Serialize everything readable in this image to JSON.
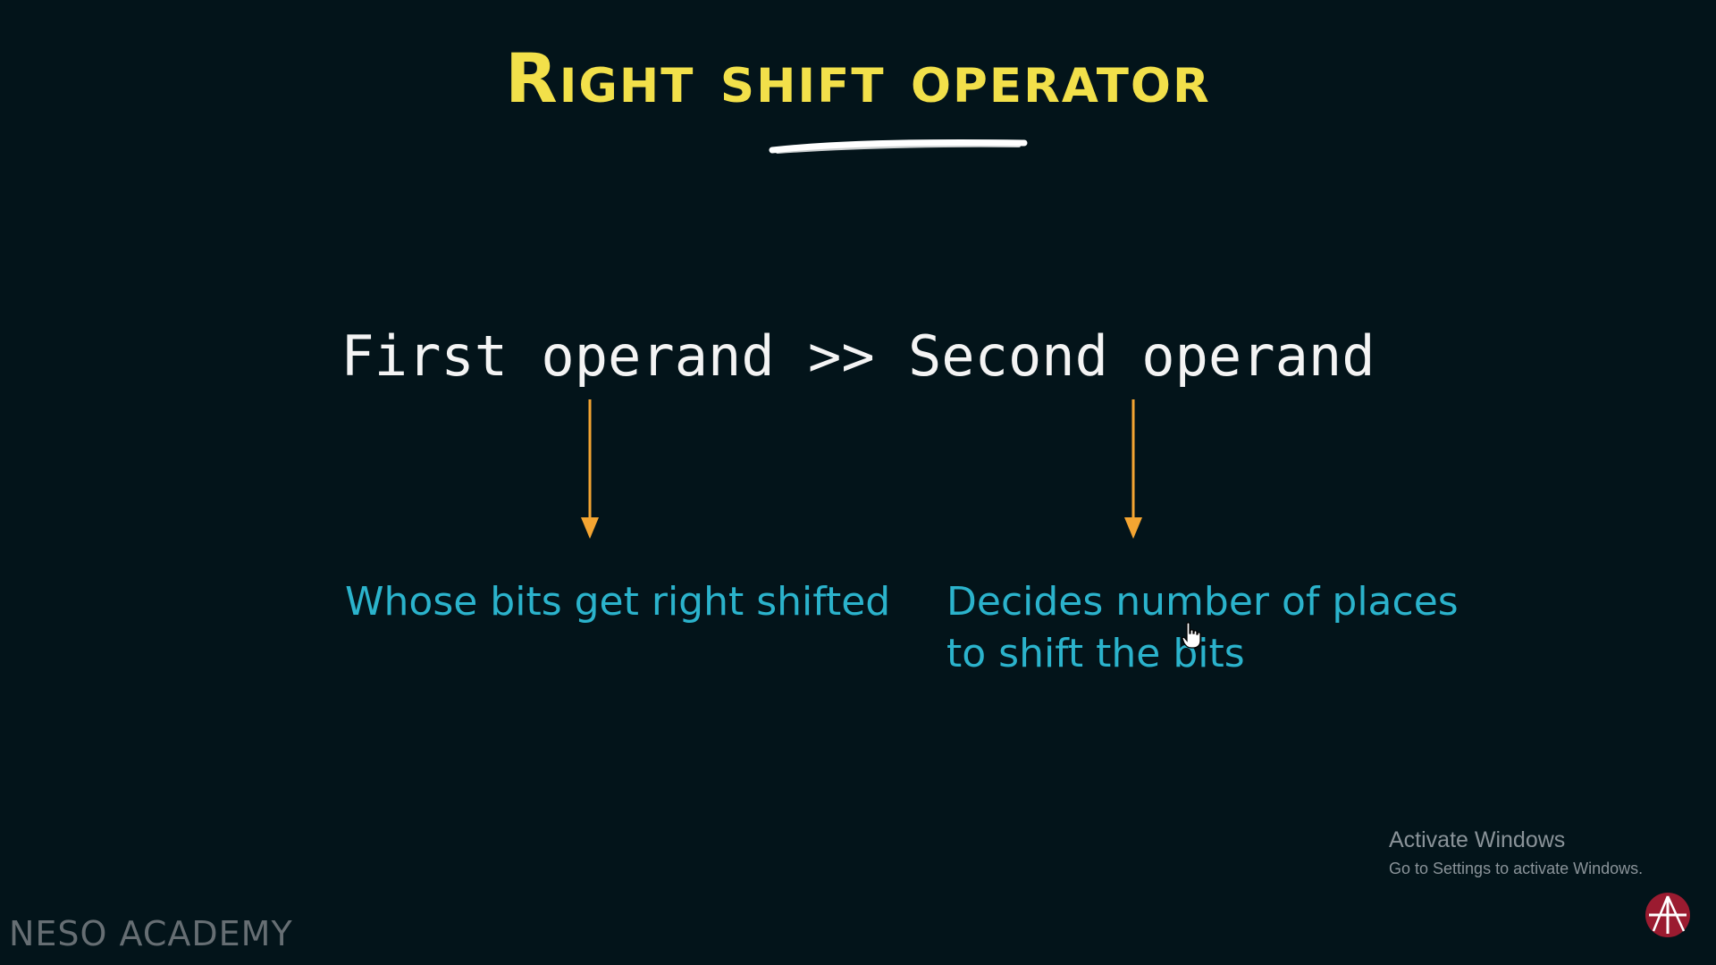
{
  "slide": {
    "title": "Right shift operator",
    "expression": "First operand >> Second operand",
    "left_description": "Whose bits get right shifted",
    "right_description_line1": "Decides number of places",
    "right_description_line2": "to shift the bits"
  },
  "watermark": {
    "title": "Activate Windows",
    "subtitle": "Go to Settings to activate Windows."
  },
  "brand": {
    "name": "NESO ACADEMY"
  },
  "colors": {
    "background": "#03141a",
    "title": "#f2e04a",
    "expression": "#f4f4f4",
    "arrows": "#f4a532",
    "descriptions": "#2bb3cc",
    "logo": "#9b1b30"
  },
  "icons": {
    "arrow": "arrow-down-icon",
    "logo": "neso-logo-icon",
    "cursor": "hand-pointer-icon"
  }
}
